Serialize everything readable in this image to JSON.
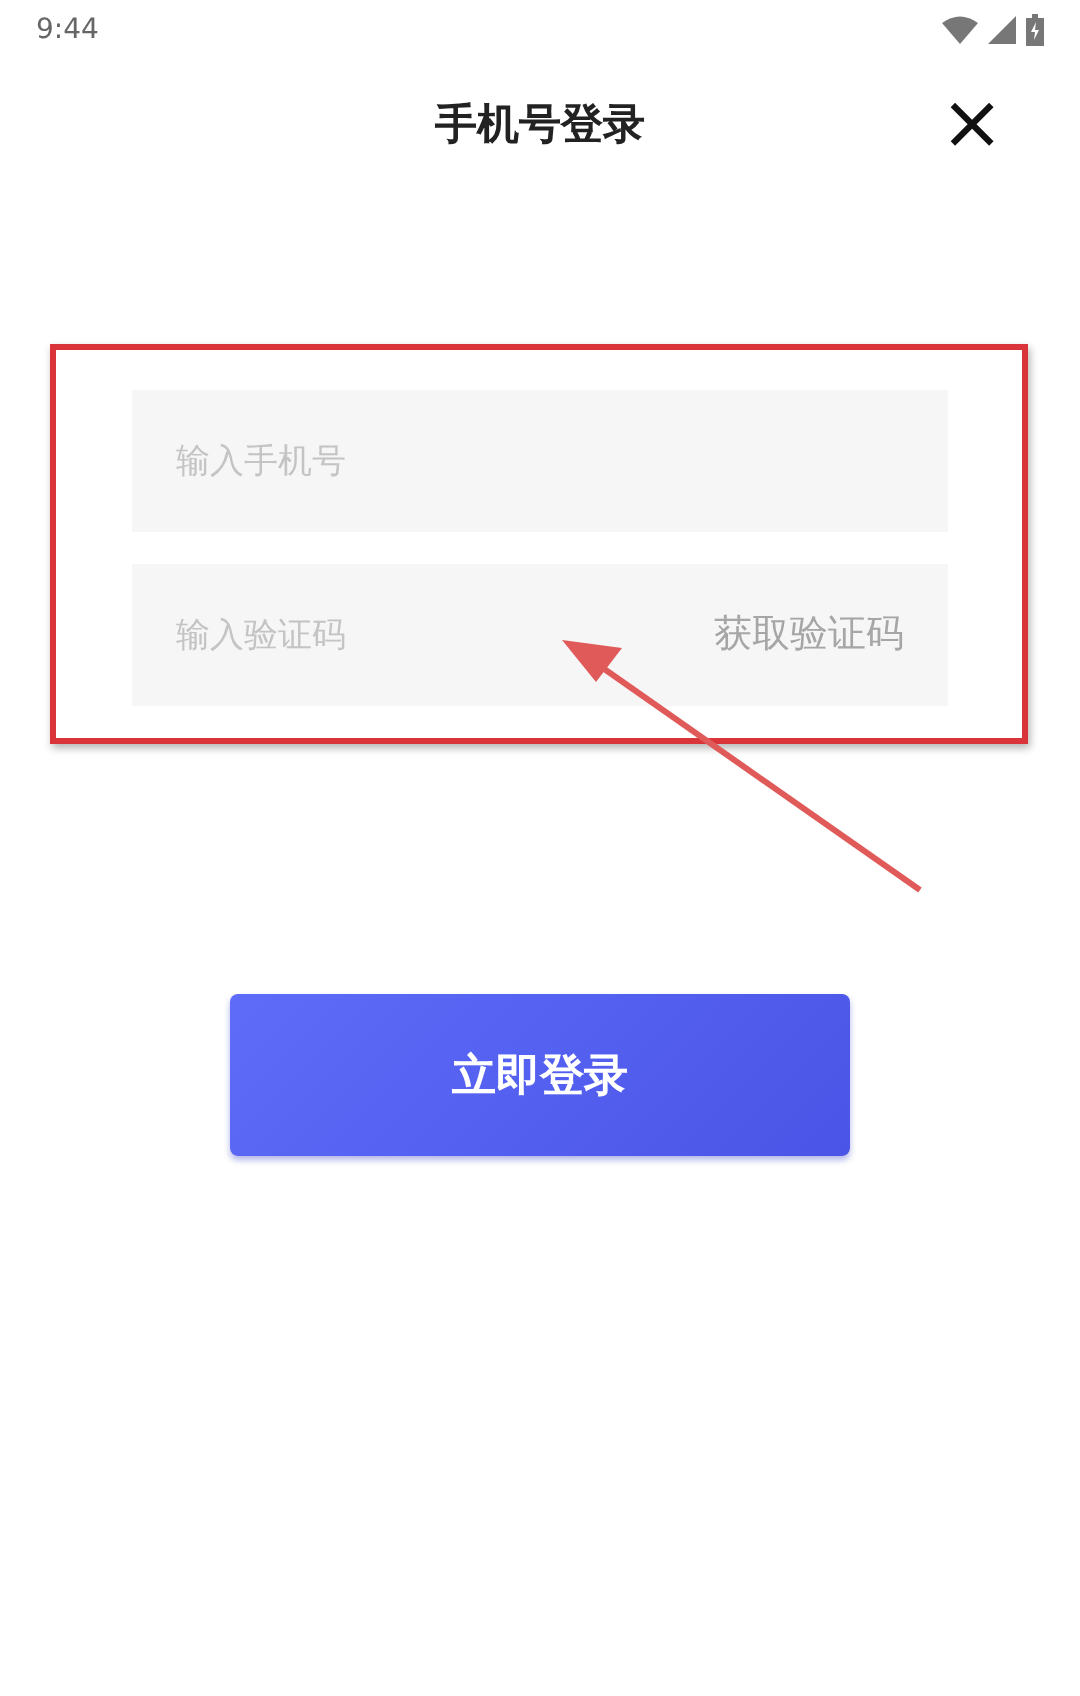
{
  "status_bar": {
    "time": "9:44"
  },
  "header": {
    "title": "手机号登录",
    "close": "×"
  },
  "form": {
    "phone": {
      "placeholder": "输入手机号"
    },
    "code": {
      "placeholder": "输入验证码",
      "action": "获取验证码"
    }
  },
  "submit": {
    "label": "立即登录"
  }
}
